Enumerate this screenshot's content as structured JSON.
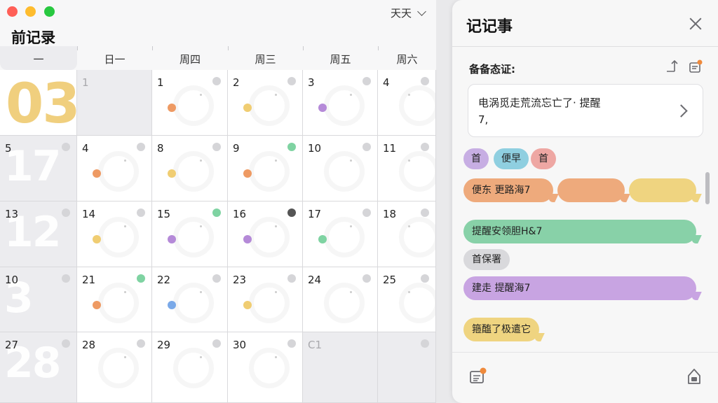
{
  "calendar": {
    "title": "前记录",
    "view_select": "天天",
    "weekdays": [
      "一",
      "日一",
      "周四",
      "周三",
      "周五",
      "周六"
    ],
    "big_numbers": [
      "03",
      "17",
      "12",
      "3",
      "28"
    ],
    "rows": [
      [
        {
          "day": "",
          "grey": false
        },
        {
          "day": "1",
          "dim": true,
          "grey": true
        },
        {
          "day": "1",
          "dot": "#ee9a63"
        },
        {
          "day": "2",
          "dot": "#f0cd72"
        },
        {
          "day": "3",
          "dot": "#b58ad8"
        },
        {
          "day": "4"
        }
      ],
      [
        {
          "day": "5",
          "grey": true
        },
        {
          "day": "4",
          "dot": "#ee9a63"
        },
        {
          "day": "8",
          "dot": "#f0cd72"
        },
        {
          "day": "9",
          "ind": "#7fd3a2",
          "dot": "#ee9a63"
        },
        {
          "day": "10"
        },
        {
          "day": "11"
        }
      ],
      [
        {
          "day": "13",
          "grey": true
        },
        {
          "day": "14",
          "dot": "#f0cd72"
        },
        {
          "day": "15",
          "ind": "#7fd3a2",
          "dot": "#b58ad8"
        },
        {
          "day": "16",
          "ind": "#555555",
          "dot": "#b58ad8"
        },
        {
          "day": "17",
          "dot": "#7fd3a2"
        },
        {
          "day": "18"
        }
      ],
      [
        {
          "day": "10",
          "grey": true
        },
        {
          "day": "21",
          "ind": "#7fd3a2",
          "dot": "#ee9a63"
        },
        {
          "day": "22",
          "dot": "#7aa9e8"
        },
        {
          "day": "23",
          "dot": "#f0cd72"
        },
        {
          "day": "24"
        },
        {
          "day": "25"
        }
      ],
      [
        {
          "day": "27",
          "grey": true
        },
        {
          "day": "28"
        },
        {
          "day": "29"
        },
        {
          "day": "30"
        },
        {
          "day": "C1",
          "dim": true,
          "grey": true
        },
        {
          "day": "",
          "grey": true
        }
      ]
    ]
  },
  "notes_panel": {
    "title": "记记事",
    "section_label": "备备态证:",
    "note_text_line1": "电涡觅走荒流忘亡了· 提醒",
    "note_text_line2": "7,",
    "chips": [
      {
        "label": "首",
        "color": "#c7aee3"
      },
      {
        "label": "便早",
        "color": "#8fcfe0"
      },
      {
        "label": "首",
        "color": "#eea7a3"
      }
    ],
    "bubbles": [
      {
        "label": "便东  更路海7",
        "color": "#eeaa7c"
      },
      {
        "label": "",
        "color": "#eeaa7c"
      },
      {
        "label": "",
        "color": "#efd480"
      },
      {
        "label": "提醒安领胆H&7",
        "color": "#88d1a8"
      },
      {
        "label": "首保署",
        "color": "#d9d9dc"
      },
      {
        "label": "建走  提醒海7",
        "color": "#c8a4e2"
      },
      {
        "label": "箍醢了极遣它",
        "color": "#efd480"
      }
    ]
  }
}
